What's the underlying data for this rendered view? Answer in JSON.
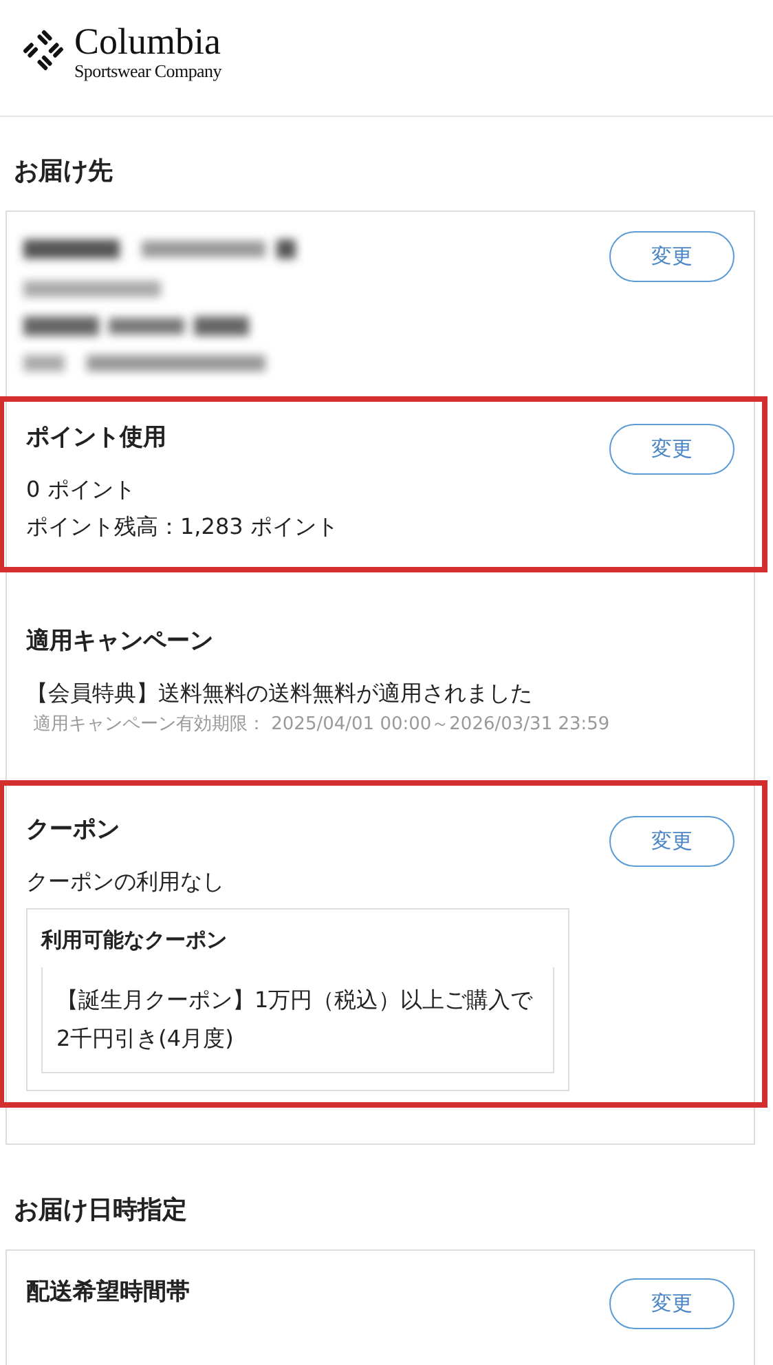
{
  "logo": {
    "name": "Columbia",
    "tagline": "Sportswear Company"
  },
  "sections": [
    {
      "heading": "お届け先",
      "blocks": [
        {
          "kind": "redacted",
          "highlighted": false,
          "button": "変更"
        },
        {
          "kind": "info",
          "highlighted": true,
          "title": "ポイント使用",
          "lines": [
            "0 ポイント",
            "ポイント残高：1,283 ポイント"
          ],
          "button": "変更"
        },
        {
          "kind": "info",
          "highlighted": false,
          "title": "適用キャンペーン",
          "lines": [
            "【会員特典】送料無料の送料無料が適用されました"
          ],
          "note": "適用キャンペーン有効期限： 2025/04/01 00:00～2026/03/31 23:59"
        },
        {
          "kind": "coupon",
          "highlighted": true,
          "title": "クーポン",
          "lines": [
            "クーポンの利用なし"
          ],
          "button": "変更",
          "available": {
            "title": "利用可能なクーポン",
            "items": [
              "【誕生月クーポン】1万円（税込）以上ご購入で2千円引き(4月度)"
            ]
          }
        }
      ]
    },
    {
      "heading": "お届け日時指定",
      "blocks": [
        {
          "kind": "info",
          "highlighted": false,
          "title": "配送希望時間帯",
          "button": "変更"
        }
      ]
    }
  ]
}
